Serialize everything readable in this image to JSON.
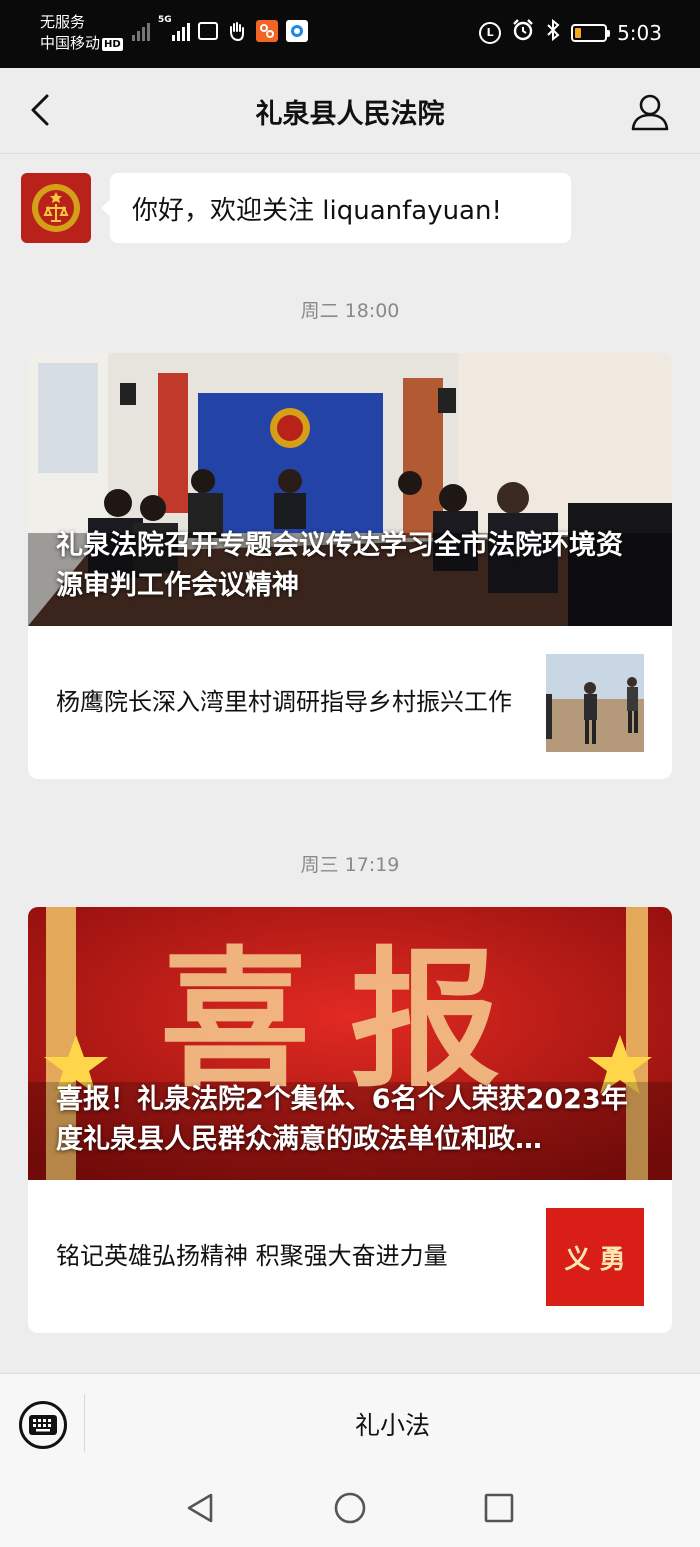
{
  "status_bar": {
    "carrier_line1": "无服务",
    "carrier_line2": "中国移动",
    "hd": "HD",
    "net": "5G",
    "time": "5:03"
  },
  "header": {
    "title": "礼泉县人民法院"
  },
  "greeting": {
    "text": "你好，欢迎关注 liquanfayuan!"
  },
  "messages": [
    {
      "time": "周二 18:00",
      "cover_title": "礼泉法院召开专题会议传达学习全市法院环境资源审判工作会议精神",
      "sub_title": "杨鹰院长深入湾里村调研指导乡村振兴工作"
    },
    {
      "time": "周三 17:19",
      "cover_title": "喜报！礼泉法院2个集体、6名个人荣获2023年度礼泉县人民群众满意的政法单位和政…",
      "cover_banner_text": "喜报",
      "sub_title": "铭记英雄弘扬精神 积聚强大奋进力量",
      "thumb_text": "义 勇"
    }
  ],
  "bottom_menu": {
    "item": "礼小法"
  }
}
